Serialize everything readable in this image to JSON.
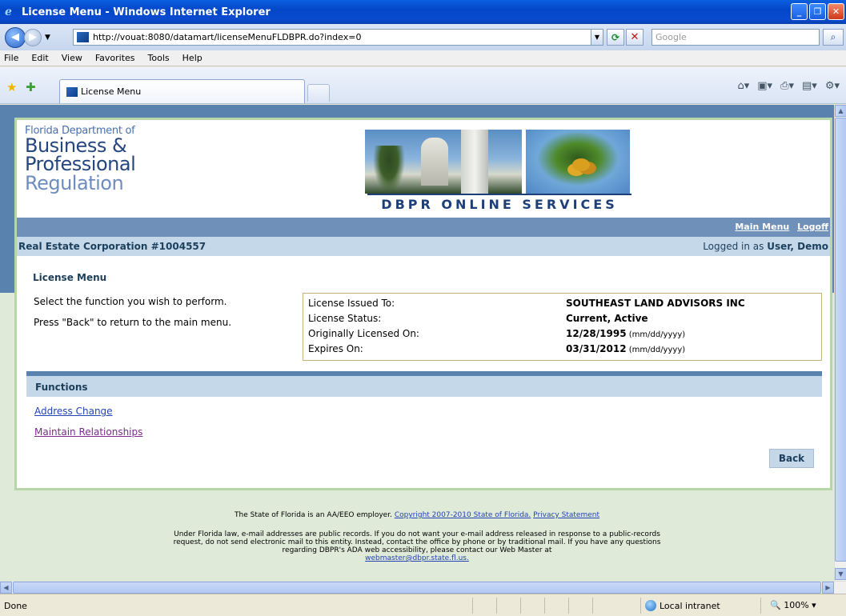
{
  "window": {
    "title": "License Menu - Windows Internet Explorer"
  },
  "browser": {
    "url": "http://vouat:8080/datamart/licenseMenuFLDBPR.do?index=0",
    "search_placeholder": "Google",
    "menu": [
      "File",
      "Edit",
      "View",
      "Favorites",
      "Tools",
      "Help"
    ],
    "tab_label": "License Menu"
  },
  "status": {
    "text": "Done",
    "zone": "Local intranet",
    "zoom": "100%"
  },
  "header": {
    "logo_line1": "Florida Department of",
    "logo_line2": "Business &",
    "logo_line3": "Professional",
    "logo_line4": "Regulation",
    "tagline": "DBPR ONLINE SERVICES"
  },
  "nav": {
    "main_menu": "Main Menu",
    "logoff": "Logoff"
  },
  "infobar": {
    "entity": "Real Estate Corporation #1004557",
    "logged_prefix": "Logged in as ",
    "user": "User, Demo"
  },
  "page": {
    "title": "License Menu",
    "instruction1": "Select the function you wish to perform.",
    "instruction2": "Press \"Back\" to return to the main menu."
  },
  "license": {
    "rows": [
      {
        "label": "License Issued To:",
        "value": "SOUTHEAST LAND ADVISORS INC",
        "hint": ""
      },
      {
        "label": "License Status:",
        "value": "Current, Active",
        "hint": ""
      },
      {
        "label": "Originally Licensed On:",
        "value": "12/28/1995",
        "hint": " (mm/dd/yyyy)"
      },
      {
        "label": "Expires On:",
        "value": "03/31/2012",
        "hint": " (mm/dd/yyyy)"
      }
    ]
  },
  "functions": {
    "heading": "Functions",
    "links": [
      "Address Change",
      "Maintain Relationships"
    ],
    "back_label": "Back"
  },
  "footer": {
    "employer": "The State of Florida is an AA/EEO employer.",
    "copyright": "Copyright 2007-2010 State of Florida.",
    "privacy": "Privacy Statement",
    "notice": "Under Florida law, e-mail addresses are public records. If you do not want your e-mail address released in response to a public-records request, do not send electronic mail to this entity. Instead, contact the office by phone or by traditional mail. If you have any questions regarding DBPR's ADA web accessibility, please contact our Web Master at",
    "email": "webmaster@dbpr.state.fl.us."
  }
}
